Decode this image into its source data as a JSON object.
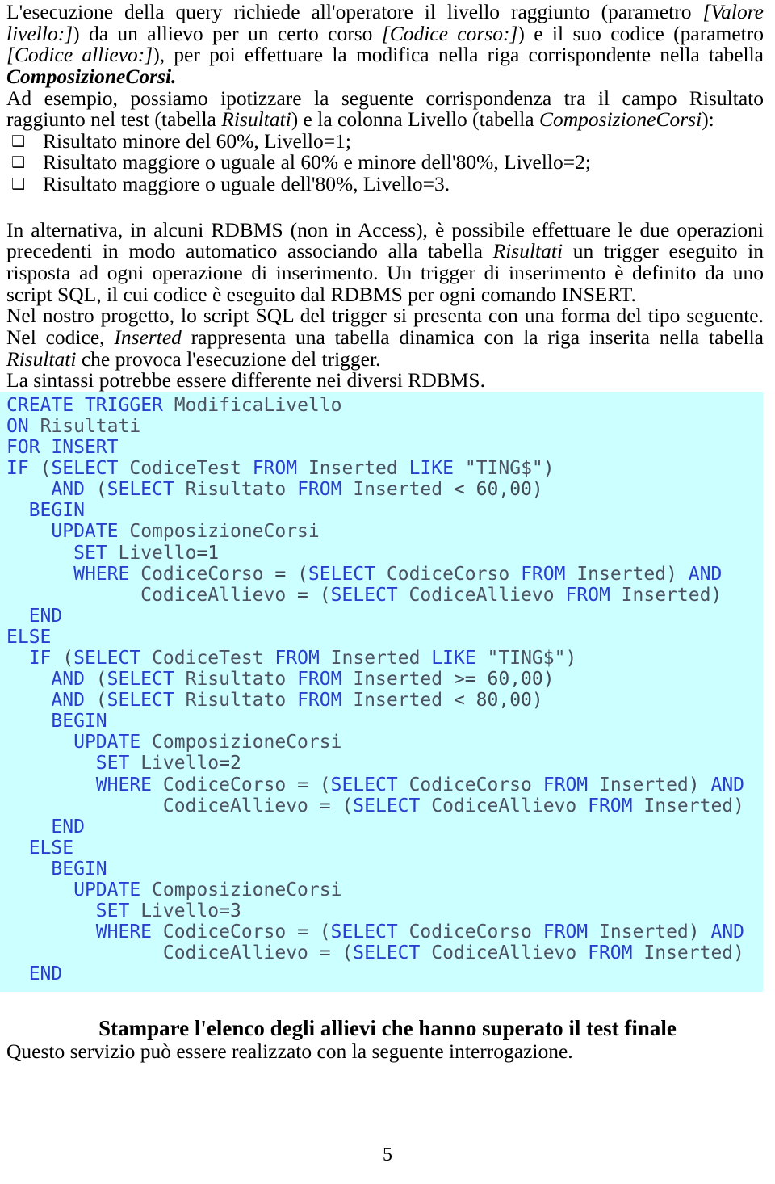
{
  "document": {
    "page_number": "5"
  },
  "paragraphs": {
    "intro": {
      "s1": "L'esecuzione della query richiede all'operatore il livello raggiunto (parametro ",
      "i1": "[Valore livello:]",
      "s2": ") da un allievo per un certo corso ",
      "i2": "[Codice corso:]",
      "s3": ") e il suo codice (parametro ",
      "i3": "[Codice allievo:]",
      "s4": "), per poi effettuare la modifica nella riga corrispondente nella tabella ",
      "i4": "ComposizioneCorsi."
    },
    "example_intro": {
      "s1": "Ad esempio, possiamo ipotizzare la seguente corrispondenza tra il campo Risultato raggiunto nel test (tabella ",
      "i1": "Risultati",
      "s2": ") e la colonna Livello (tabella ",
      "i2": "ComposizioneCorsi",
      "s3": "):"
    },
    "alternative": {
      "s1": "In alternativa, in alcuni RDBMS (non in Access), è possibile effettuare le due operazioni precedenti in modo automatico associando alla tabella ",
      "i1": "Risultati",
      "s2": " un trigger eseguito in risposta ad ogni operazione di inserimento. Un trigger di inserimento è definito da uno script SQL, il cui codice è eseguito dal RDBMS per ogni comando INSERT."
    },
    "project_note": {
      "s1": "Nel nostro progetto, lo script SQL del trigger si presenta con una forma del tipo seguente. Nel codice, ",
      "i1": "Inserted",
      "s2": " rappresenta una tabella dinamica con la riga inserita nella tabella ",
      "i2": "Risultati",
      "s3": " che provoca l'esecuzione del trigger."
    },
    "syntax_note": "La sintassi potrebbe essere differente nei diversi RDBMS."
  },
  "bullets": {
    "glyph": "❑",
    "items": [
      "Risultato minore del 60%, Livello=1;",
      "Risultato maggiore o uguale al 60% e minore dell'80%, Livello=2;",
      "Risultato maggiore o uguale dell'80%, Livello=3."
    ]
  },
  "code": {
    "language": "sql",
    "background_color": "#ccffff",
    "keyword_color": "#2a3fcf",
    "identifier_color": "#4d5360",
    "text": "CREATE TRIGGER ModificaLivello\nON Risultati\nFOR INSERT\nIF (SELECT CodiceTest FROM Inserted LIKE \"TING$\")\n    AND (SELECT Risultato FROM Inserted < 60,00)\n  BEGIN\n    UPDATE ComposizioneCorsi\n      SET Livello=1\n      WHERE CodiceCorso = (SELECT CodiceCorso FROM Inserted) AND\n            CodiceAllievo = (SELECT CodiceAllievo FROM Inserted)\n  END\nELSE\n  IF (SELECT CodiceTest FROM Inserted LIKE \"TING$\")\n    AND (SELECT Risultato FROM Inserted >= 60,00)\n    AND (SELECT Risultato FROM Inserted < 80,00)\n    BEGIN\n      UPDATE ComposizioneCorsi\n        SET Livello=2\n        WHERE CodiceCorso = (SELECT CodiceCorso FROM Inserted) AND\n              CodiceAllievo = (SELECT CodiceAllievo FROM Inserted)\n    END\n  ELSE\n    BEGIN\n      UPDATE ComposizioneCorsi\n        SET Livello=3\n        WHERE CodiceCorso = (SELECT CodiceCorso FROM Inserted) AND\n              CodiceAllievo = (SELECT CodiceAllievo FROM Inserted)\n  END"
  },
  "section": {
    "heading": "Stampare l'elenco degli allievi che hanno superato il test finale",
    "note": "Questo servizio può essere realizzato con la seguente interrogazione."
  }
}
